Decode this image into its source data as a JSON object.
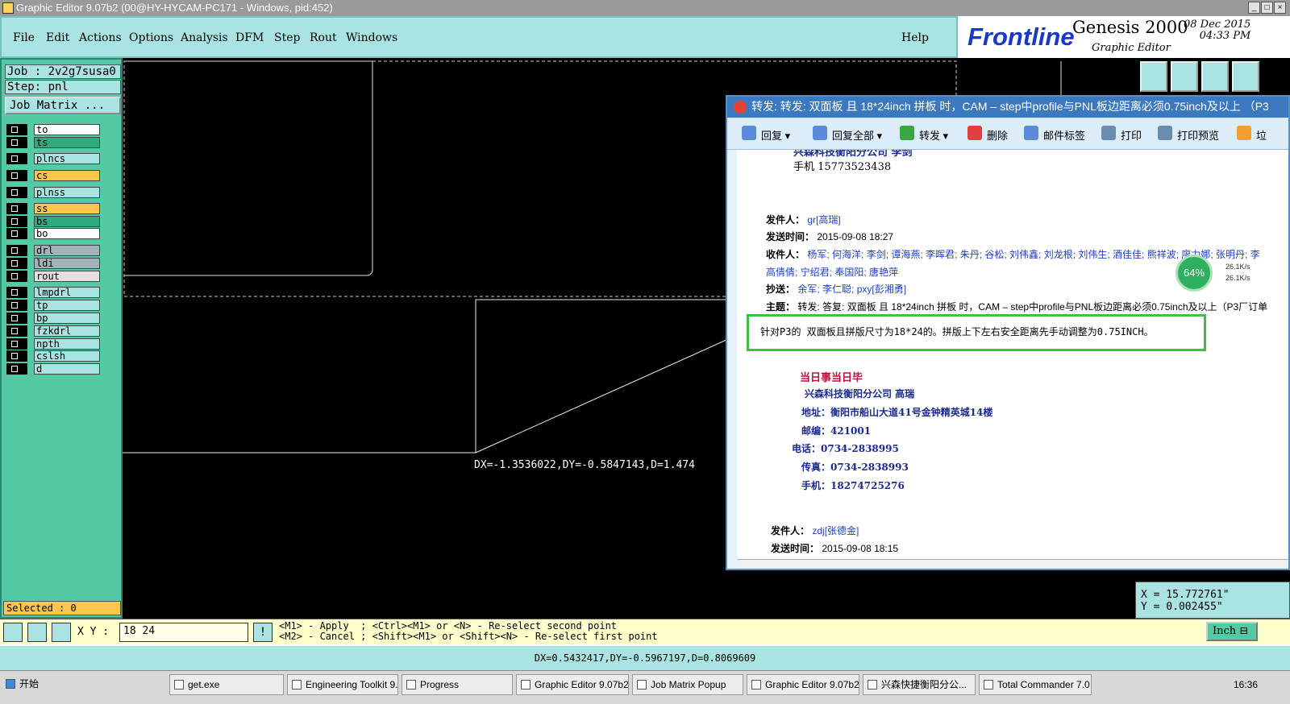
{
  "window": {
    "title": "Graphic Editor 9.07b2 (00@HY-HYCAM-PC171 - Windows, pid:452)"
  },
  "menu": {
    "file": "File",
    "edit": "Edit",
    "actions": "Actions",
    "options": "Options",
    "analysis": "Analysis",
    "dfm": "DFM",
    "step": "Step",
    "rout": "Rout",
    "windows": "Windows",
    "help": "Help"
  },
  "brand": {
    "logo": "Frontline",
    "product": "Genesis 2000",
    "subtitle": "Graphic Editor",
    "date": "08 Dec 2015",
    "time": "04:33 PM"
  },
  "job": {
    "job_label": "Job : 2v2g7susa0",
    "step_label": "Step: pnl",
    "matrix_button": "Job Matrix ..."
  },
  "layers": [
    {
      "name": "to",
      "color": "#ffffff"
    },
    {
      "name": "ts",
      "color": "#2eaa7c"
    },
    {
      "name": "plncs",
      "color": "#a9e3e2"
    },
    {
      "name": "cs",
      "color": "#fcc64c"
    },
    {
      "name": "plnss",
      "color": "#a9e3e2"
    },
    {
      "name": "ss",
      "color": "#fcc64c"
    },
    {
      "name": "bs",
      "color": "#2eaa7c"
    },
    {
      "name": "bo",
      "color": "#ffffff"
    },
    {
      "name": "drl",
      "color": "#9fb3b8"
    },
    {
      "name": "ldi",
      "color": "#9fb3b8"
    },
    {
      "name": "rout",
      "color": "#e2e2e2"
    },
    {
      "name": "lmpdrl",
      "color": "#a9e3e2"
    },
    {
      "name": "tp",
      "color": "#a9e3e2"
    },
    {
      "name": "bp",
      "color": "#a9e3e2"
    },
    {
      "name": "fzkdrl",
      "color": "#a9e3e2"
    },
    {
      "name": "npth",
      "color": "#a9e3e2"
    },
    {
      "name": "cslsh",
      "color": "#a9e3e2"
    },
    {
      "name": "d",
      "color": "#a9e3e2"
    }
  ],
  "selected": "Selected : 0",
  "canvas": {
    "measure_text": "DX=-1.3536022,DY=-0.5847143,D=1.474"
  },
  "coords": {
    "x": "X = 15.772761\"",
    "y": "Y = 0.002455\""
  },
  "input": {
    "xy_label": "X Y :",
    "xy_value": "18 24"
  },
  "messages": {
    "line1": "<M1> - Apply  ; <Ctrl><M1> or <N> - Re-select second point",
    "line2": "<M2> - Cancel ; <Shift><M1> or <Shift><N> - Re-select first point"
  },
  "unit": "Inch",
  "status_dx": "DX=0.5432417,DY=-0.5967197,D=0.8069609",
  "mail": {
    "title": "转发: 转发: 双面板 且 18*24inch 拼板 时，CAM – step中profile与PNL板边距离必须0.75inch及以上  （P3",
    "toolbar": {
      "reply": "回复",
      "reply_all": "回复全部",
      "forward": "转发",
      "delete": "删除",
      "tag": "邮件标签",
      "print": "打印",
      "print_preview": "打印预览",
      "junk": "垃"
    },
    "top_sig": {
      "company": "兴森科技衡阳分公司  李剑",
      "phone": "手机   15773523438"
    },
    "from_label": "发件人：",
    "from": "gr[高瑞]",
    "time_label": "发送时间：",
    "time": "2015-09-08 18:27",
    "to_label": "收件人：",
    "to_line1": "杨军; 何海洋; 李剑; 谭海燕; 李晖君; 朱丹; 谷松; 刘伟鑫; 刘龙根; 刘伟生; 酒佳佳; 熊祥波; 廖力娜; 张明丹; 李",
    "to_line2": "高倩倩; 宁绍君; 奉国阳; 唐艳萍",
    "cc_label": "抄送：",
    "cc": "余军; 李仁聪; pxy[彭湘勇]",
    "subject_label": "主题：",
    "subject": "转发: 答复: 双面板 且 18*24inch 拼板 时，CAM – step中profile与PNL板边距离必须0.75inch及以上（P3厂订单",
    "body": "针对P3的  双面板且拼版尺寸为18*24的。拼版上下左右安全距离先手动调整为0.75INCH。",
    "signature": {
      "motto": "当日事当日毕",
      "company": "兴森科技衡阳分公司    高瑞",
      "address": "地址：衡阳市船山大道41号金钟精英城14楼",
      "zip": "邮编：421001",
      "tel": "电话：0734-2838995",
      "fax": "传真：0734-2838993",
      "mobile": "手机：18274725276"
    },
    "from2_label": "发件人：",
    "from2": "zdj[张德金]",
    "time2_label": "发送时间：",
    "time2": "2015-09-08 18:15",
    "speed": {
      "percent": "64%",
      "up": "26.1K/s",
      "down": "26.1K/s"
    }
  },
  "taskbar": {
    "start": "开始",
    "clock": "16:36",
    "tasks": [
      "get.exe",
      "Engineering Toolkit 9....",
      "Progress",
      "Graphic Editor 9.07b2...",
      "Job Matrix Popup",
      "Graphic Editor 9.07b2...",
      "兴森快捷衡阳分公...",
      "Total Commander 7.0 ..."
    ]
  }
}
